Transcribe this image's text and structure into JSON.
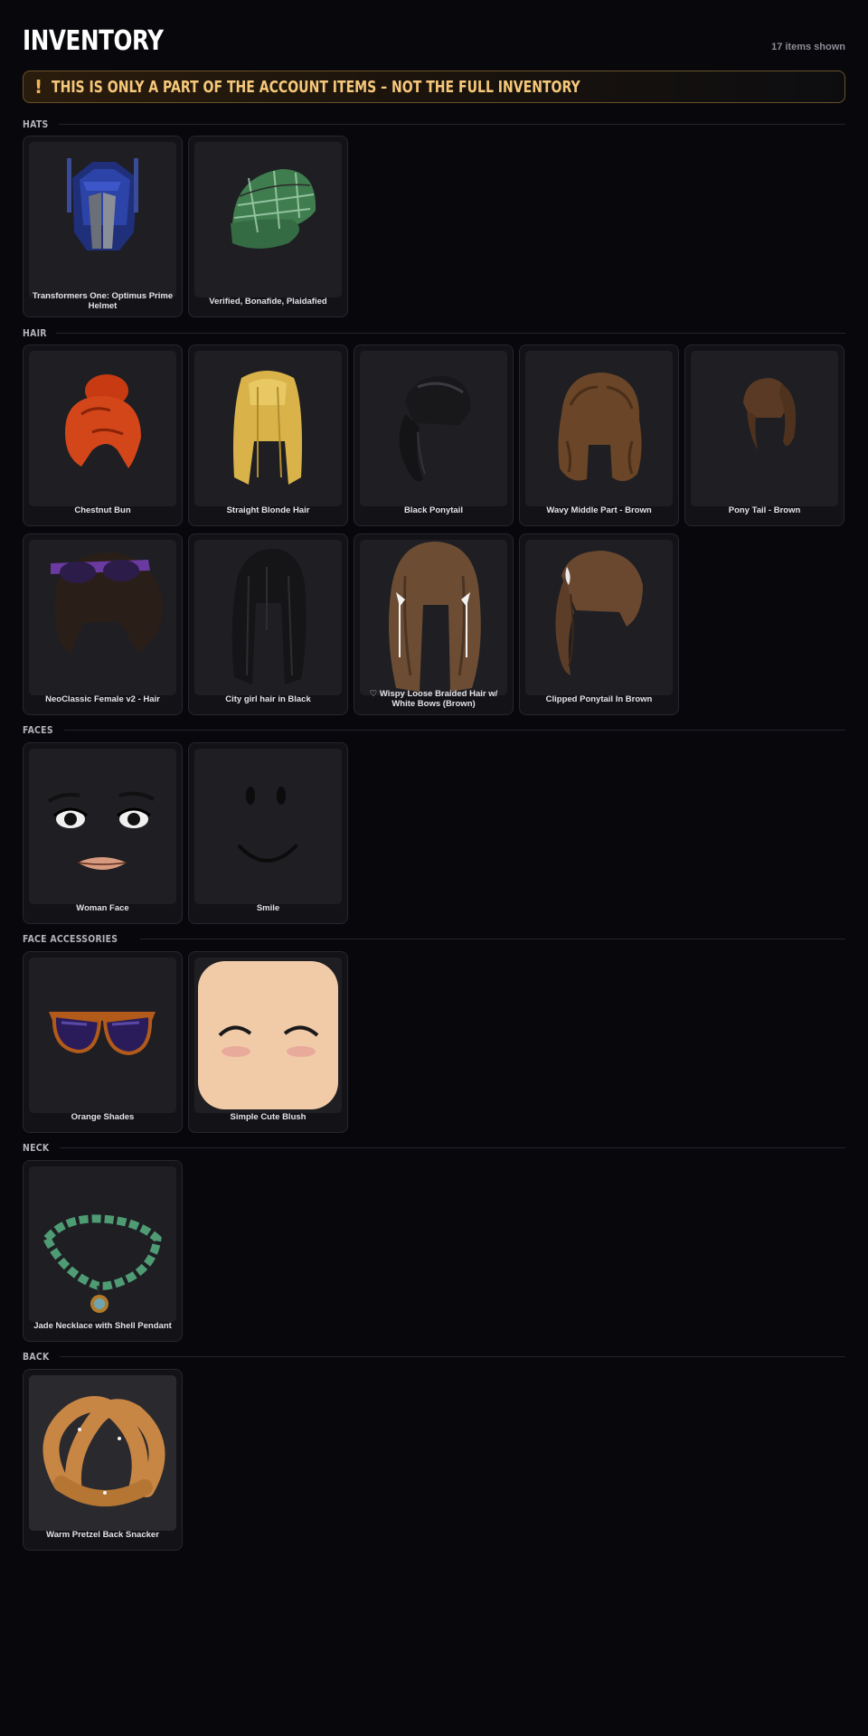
{
  "header": {
    "title": "INVENTORY",
    "count": "17 items shown"
  },
  "banner": {
    "icon": "!",
    "text": "THIS IS ONLY A PART OF THE ACCOUNT ITEMS – NOT THE FULL INVENTORY"
  },
  "sections": [
    {
      "label": "HATS",
      "items": [
        {
          "name": "Transformers One: Optimus Prime Helmet",
          "icon": "optimus-helmet-icon"
        },
        {
          "name": "Verified, Bonafide, Plaidafied",
          "icon": "plaid-cap-icon"
        }
      ]
    },
    {
      "label": "HAIR",
      "items": [
        {
          "name": "Chestnut Bun",
          "icon": "red-bun-hair-icon"
        },
        {
          "name": "Straight Blonde Hair",
          "icon": "blonde-hair-icon"
        },
        {
          "name": "Black Ponytail",
          "icon": "black-ponytail-icon"
        },
        {
          "name": "Wavy Middle Part - Brown",
          "icon": "wavy-brown-hair-icon"
        },
        {
          "name": "Pony Tail - Brown",
          "icon": "brown-ponytail-icon"
        },
        {
          "name": "NeoClassic Female v2 - Hair",
          "icon": "hair-with-glasses-icon"
        },
        {
          "name": "City girl hair in Black",
          "icon": "black-long-hair-icon"
        },
        {
          "name": "♡ Wispy Loose Braided Hair w/ White Bows (Brown)",
          "icon": "braided-hair-bows-icon"
        },
        {
          "name": "Clipped Ponytail In Brown",
          "icon": "clipped-ponytail-icon"
        }
      ]
    },
    {
      "label": "FACES",
      "items": [
        {
          "name": "Woman Face",
          "icon": "woman-face-icon"
        },
        {
          "name": "Smile",
          "icon": "smile-face-icon"
        }
      ]
    },
    {
      "label": "FACE ACCESSORIES",
      "items": [
        {
          "name": "Orange Shades",
          "icon": "orange-shades-icon"
        },
        {
          "name": "Simple Cute Blush",
          "icon": "blush-face-icon"
        }
      ]
    },
    {
      "label": "NECK",
      "items": [
        {
          "name": "Jade Necklace with Shell Pendant",
          "icon": "jade-necklace-icon"
        }
      ]
    },
    {
      "label": "BACK",
      "items": [
        {
          "name": "Warm Pretzel Back Snacker",
          "icon": "pretzel-icon"
        }
      ]
    }
  ]
}
